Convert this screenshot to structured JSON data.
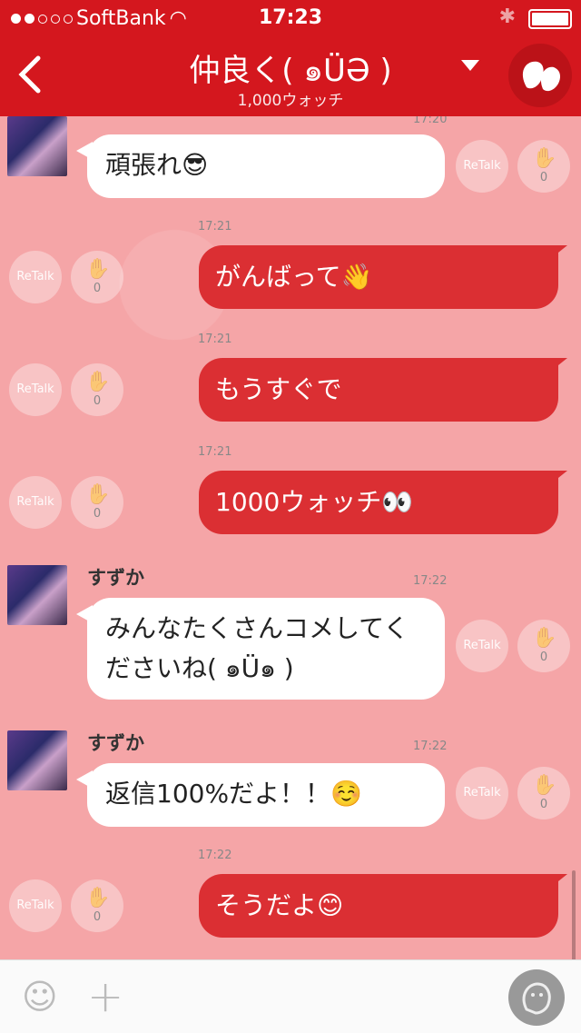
{
  "status_bar": {
    "carrier": "SoftBank",
    "time": "17:23"
  },
  "nav": {
    "title": "仲良く( ๑ÜƏ )",
    "subtitle": "1,000ウォッチ"
  },
  "actions": {
    "retalk": "ReTalk"
  },
  "messages": [
    {
      "kind": "in",
      "time": "17:20",
      "text": "頑張れ😎",
      "count": "0"
    },
    {
      "kind": "out",
      "time": "17:21",
      "text": "がんばって👋",
      "count": "0"
    },
    {
      "kind": "out",
      "time": "17:21",
      "text": "もうすぐで",
      "count": "0"
    },
    {
      "kind": "out",
      "time": "17:21",
      "text": "1000ウォッチ👀",
      "count": "0"
    },
    {
      "kind": "in",
      "sender": "すずか",
      "time": "17:22",
      "text": "みんなたくさんコメしてくださいね( ๑Ü๑ )",
      "count": "0"
    },
    {
      "kind": "in",
      "sender": "すずか",
      "time": "17:22",
      "text": "返信100%だよ！！☺️",
      "count": "0"
    },
    {
      "kind": "out",
      "time": "17:22",
      "text": "そうだよ😊",
      "count": "0"
    }
  ]
}
